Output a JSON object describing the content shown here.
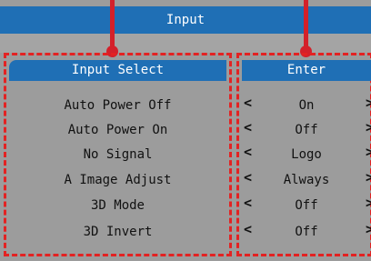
{
  "menu": {
    "title": "Input",
    "left_header": "Input Select",
    "right_header": "Enter"
  },
  "rows": [
    {
      "label": "Auto Power Off",
      "value": "On"
    },
    {
      "label": "Auto Power On",
      "value": "Off"
    },
    {
      "label": "No Signal",
      "value": "Logo"
    },
    {
      "label": "A Image Adjust",
      "value": "Always"
    },
    {
      "label": "3D Mode",
      "value": "Off"
    },
    {
      "label": "3D Invert",
      "value": "Off"
    }
  ],
  "arrows": {
    "left": "<",
    "right": ">"
  },
  "colors": {
    "header_blue": "#1f6fb5",
    "panel_gray": "#9c9c9c",
    "highlight_red": "#e32222"
  }
}
